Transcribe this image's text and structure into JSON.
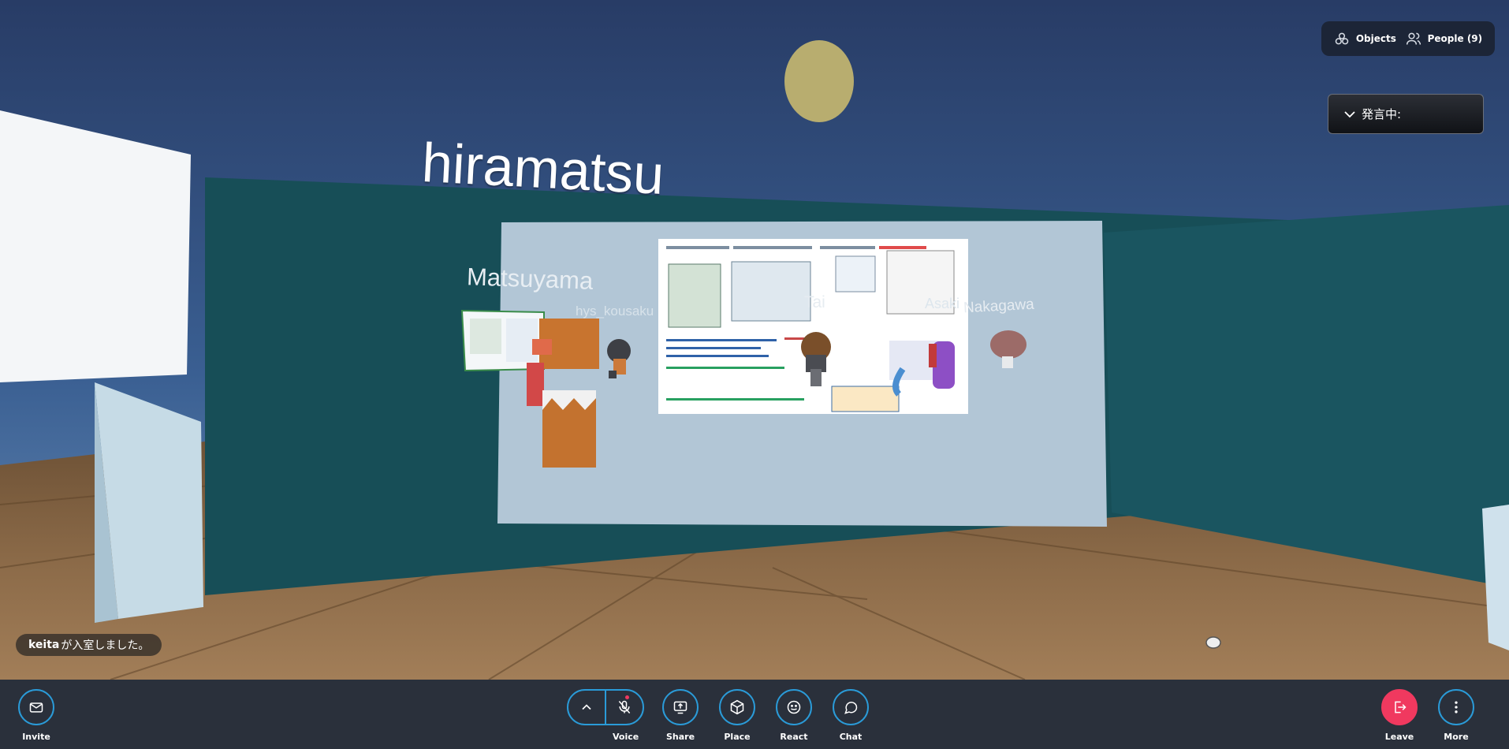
{
  "scene": {
    "name_tags": [
      {
        "name": "hiramatsu"
      },
      {
        "name": "Matsuyama"
      },
      {
        "name": "hys_kousaku"
      },
      {
        "name": "Tai"
      },
      {
        "name": "Asaki"
      },
      {
        "name": "Nakagawa"
      }
    ]
  },
  "top_right": {
    "objects_label": "Objects",
    "people_label": "People (9)"
  },
  "speaking_panel": {
    "label": "発言中:"
  },
  "notification": {
    "user": "keita",
    "message": " が入室しました。"
  },
  "toolbar": {
    "invite_label": "Invite",
    "voice_label": "Voice",
    "share_label": "Share",
    "place_label": "Place",
    "react_label": "React",
    "chat_label": "Chat",
    "leave_label": "Leave",
    "more_label": "More"
  },
  "colors": {
    "toolbar_bg": "#2a303b",
    "accent": "#2a9bd8",
    "leave": "#f0395f"
  }
}
